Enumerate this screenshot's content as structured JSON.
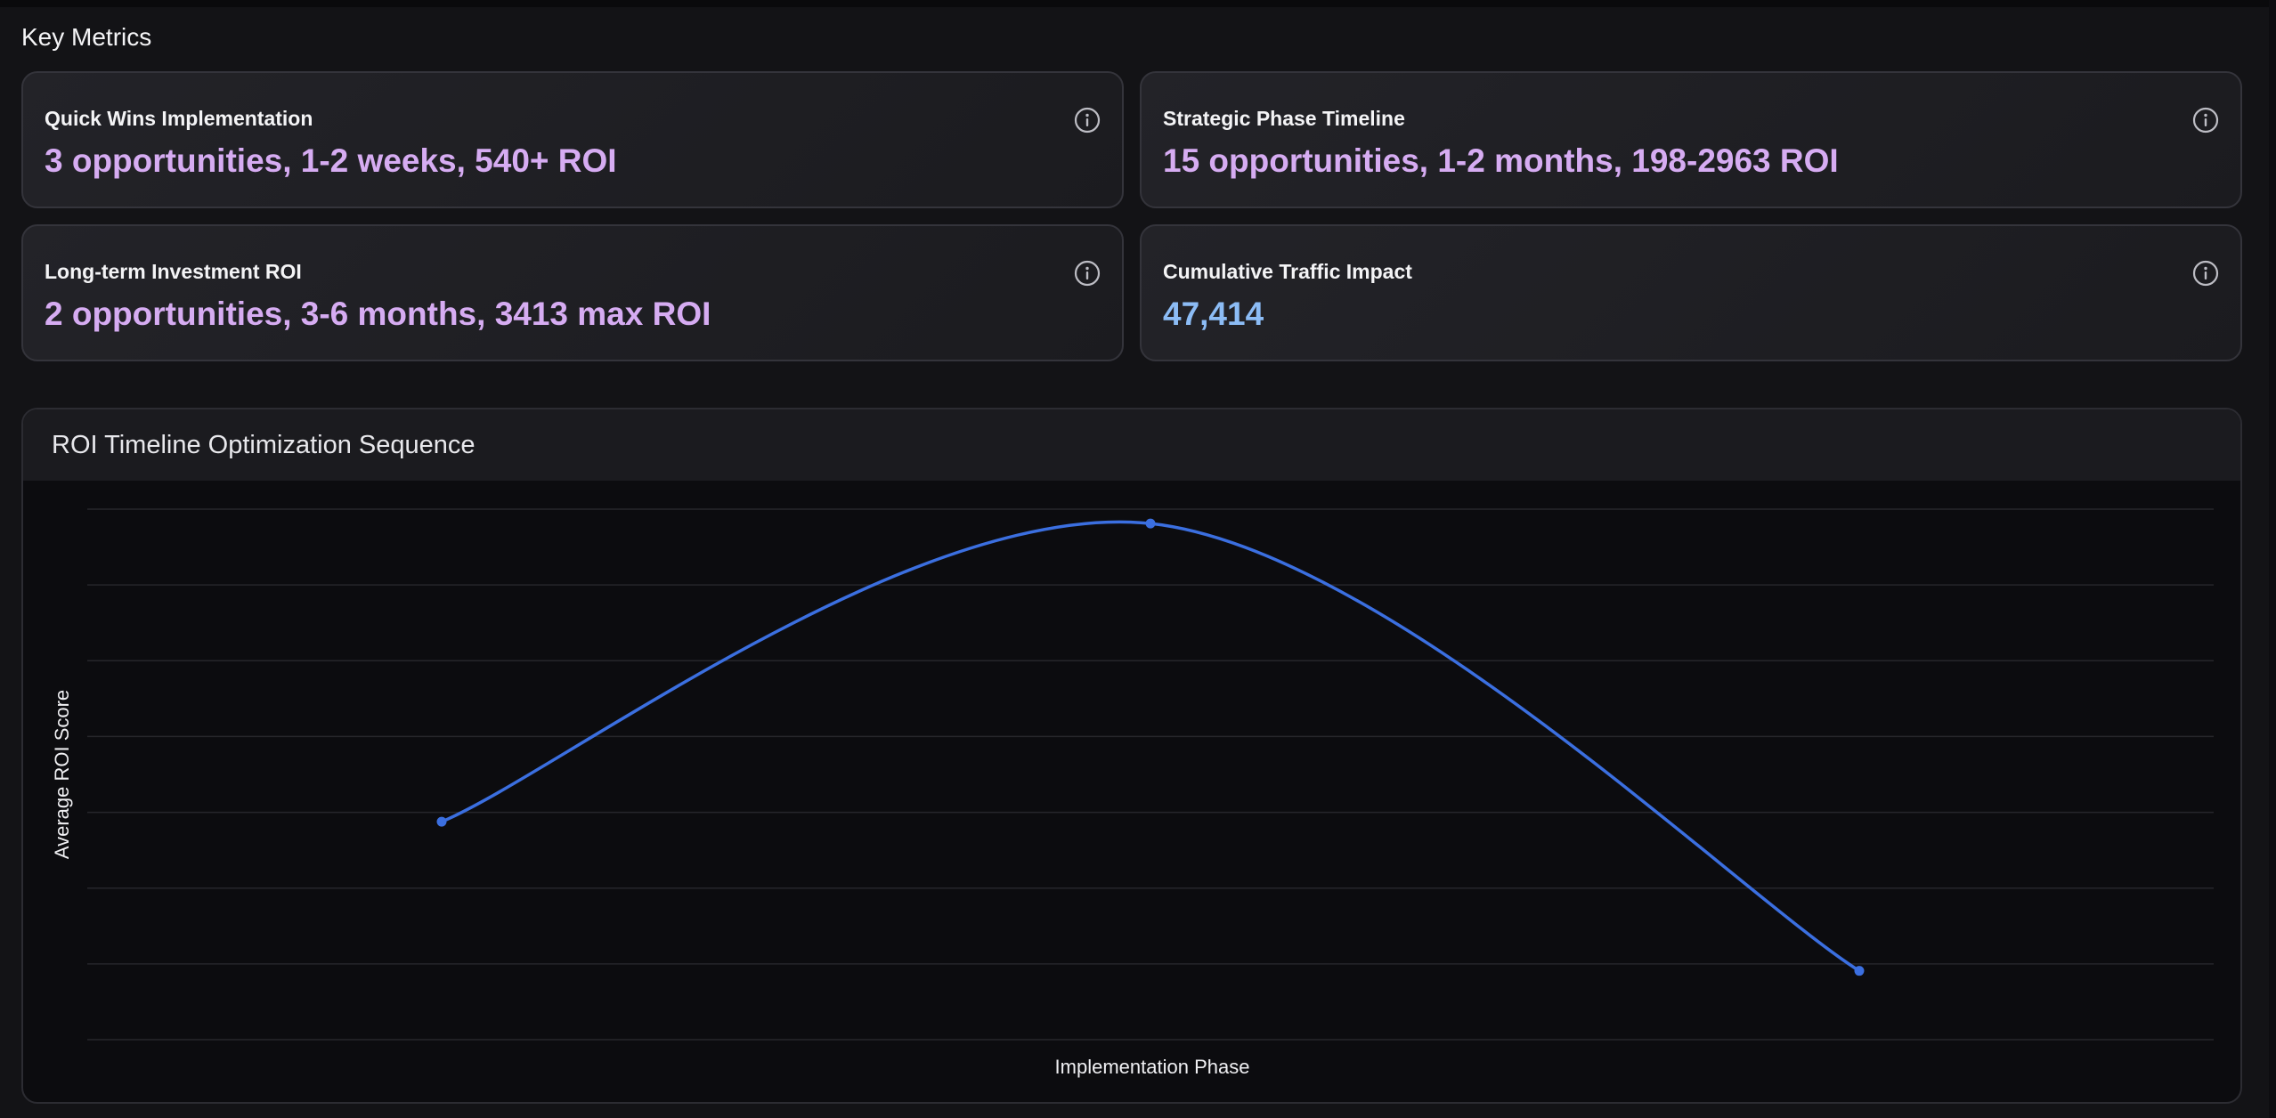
{
  "section": {
    "title": "Key Metrics"
  },
  "metrics": [
    {
      "label": "Quick Wins Implementation",
      "value": "3 opportunities, 1-2 weeks, 540+ ROI",
      "info_icon": "info-icon"
    },
    {
      "label": "Strategic Phase Timeline",
      "value": "15 opportunities, 1-2 months, 198-2963 ROI",
      "info_icon": "info-icon"
    },
    {
      "label": "Long-term Investment ROI",
      "value": "2 opportunities, 3-6 months, 3413 max ROI",
      "info_icon": "info-icon"
    },
    {
      "label": "Cumulative Traffic Impact",
      "value": "47,414",
      "info_icon": "info-icon"
    }
  ],
  "colors": {
    "metric_value": "#d6acf2",
    "metric_value_traffic": "#8cbcf5",
    "line": "#3b6fe0"
  },
  "chart": {
    "title": "ROI Timeline Optimization Sequence"
  },
  "chart_data": {
    "type": "line",
    "title": "ROI Timeline Optimization Sequence",
    "xlabel": "Implementation Phase",
    "ylabel": "Average ROI Score",
    "x": [
      1,
      2,
      3
    ],
    "series": [
      {
        "values": [
          1520,
          3600,
          480
        ]
      }
    ],
    "ylim": [
      0,
      3700
    ],
    "xlim": [
      0.5,
      3.5
    ],
    "smooth": true,
    "grid": true,
    "tick_labels_visible": false
  }
}
